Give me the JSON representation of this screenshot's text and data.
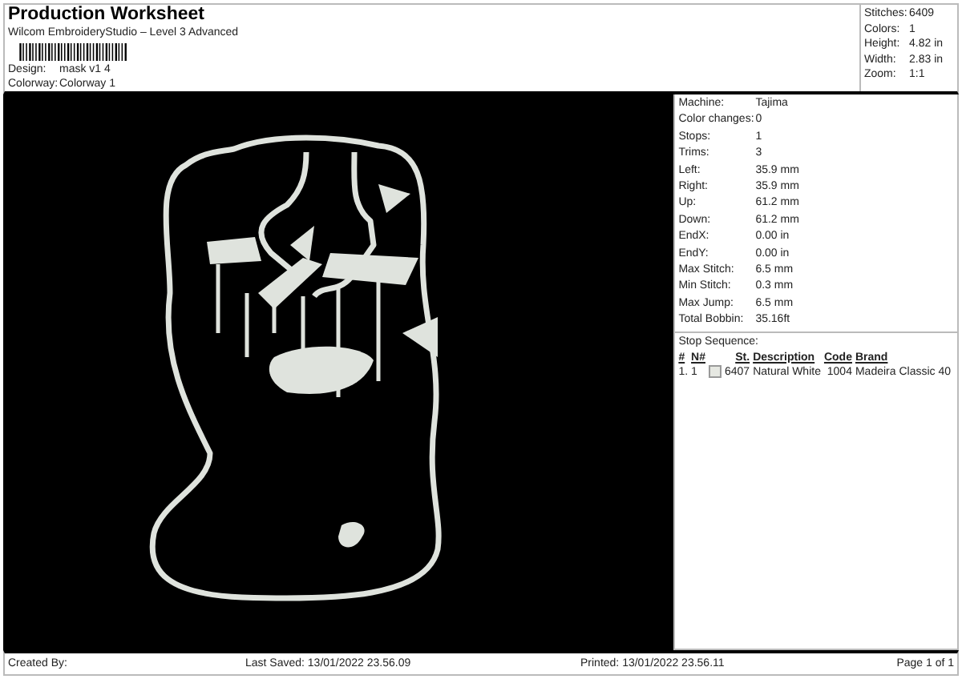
{
  "header": {
    "title": "Production Worksheet",
    "subtitle": "Wilcom EmbroideryStudio – Level 3 Advanced",
    "fields": [
      {
        "label": "Design:",
        "value": "mask v1 4"
      },
      {
        "label": "Colorway:",
        "value": "Colorway 1"
      }
    ]
  },
  "summary": [
    {
      "label": "Stitches:",
      "value": "6409"
    },
    {
      "label": "Colors:",
      "value": "1"
    },
    {
      "label": "Height:",
      "value": "4.82 in"
    },
    {
      "label": "Width:",
      "value": "2.83 in"
    },
    {
      "label": "Zoom:",
      "value": "1:1"
    }
  ],
  "details": [
    {
      "label": "Machine:",
      "value": "Tajima"
    },
    {
      "label": "Color changes:",
      "value": "0"
    },
    {
      "label": "Stops:",
      "value": "1"
    },
    {
      "label": "Trims:",
      "value": "3"
    },
    {
      "label": "Left:",
      "value": "35.9 mm"
    },
    {
      "label": "Right:",
      "value": "35.9 mm"
    },
    {
      "label": "Up:",
      "value": "61.2 mm"
    },
    {
      "label": "Down:",
      "value": "61.2 mm"
    },
    {
      "label": "EndX:",
      "value": "0.00 in"
    },
    {
      "label": "EndY:",
      "value": "0.00 in"
    },
    {
      "label": "Max Stitch:",
      "value": "6.5 mm"
    },
    {
      "label": "Min Stitch:",
      "value": "0.3 mm"
    },
    {
      "label": "Max Jump:",
      "value": "6.5 mm"
    },
    {
      "label": "Total Bobbin:",
      "value": "35.16ft"
    }
  ],
  "stop_sequence": {
    "title": "Stop Sequence:",
    "columns": [
      "#",
      "N#",
      "St.",
      "Description",
      "Code",
      "Brand"
    ],
    "rows": [
      {
        "index": "1.",
        "needle": "1",
        "color": "#e6e8e2",
        "stitches": "6407",
        "description": "Natural White",
        "code": "1004",
        "brand": "Madeira Classic 40"
      }
    ]
  },
  "footer": {
    "created_by": "Created By:",
    "last_saved": "Last Saved: 13/01/2022 23.56.09",
    "printed": "Printed: 13/01/2022 23.56.11",
    "page": "Page 1 of 1"
  }
}
